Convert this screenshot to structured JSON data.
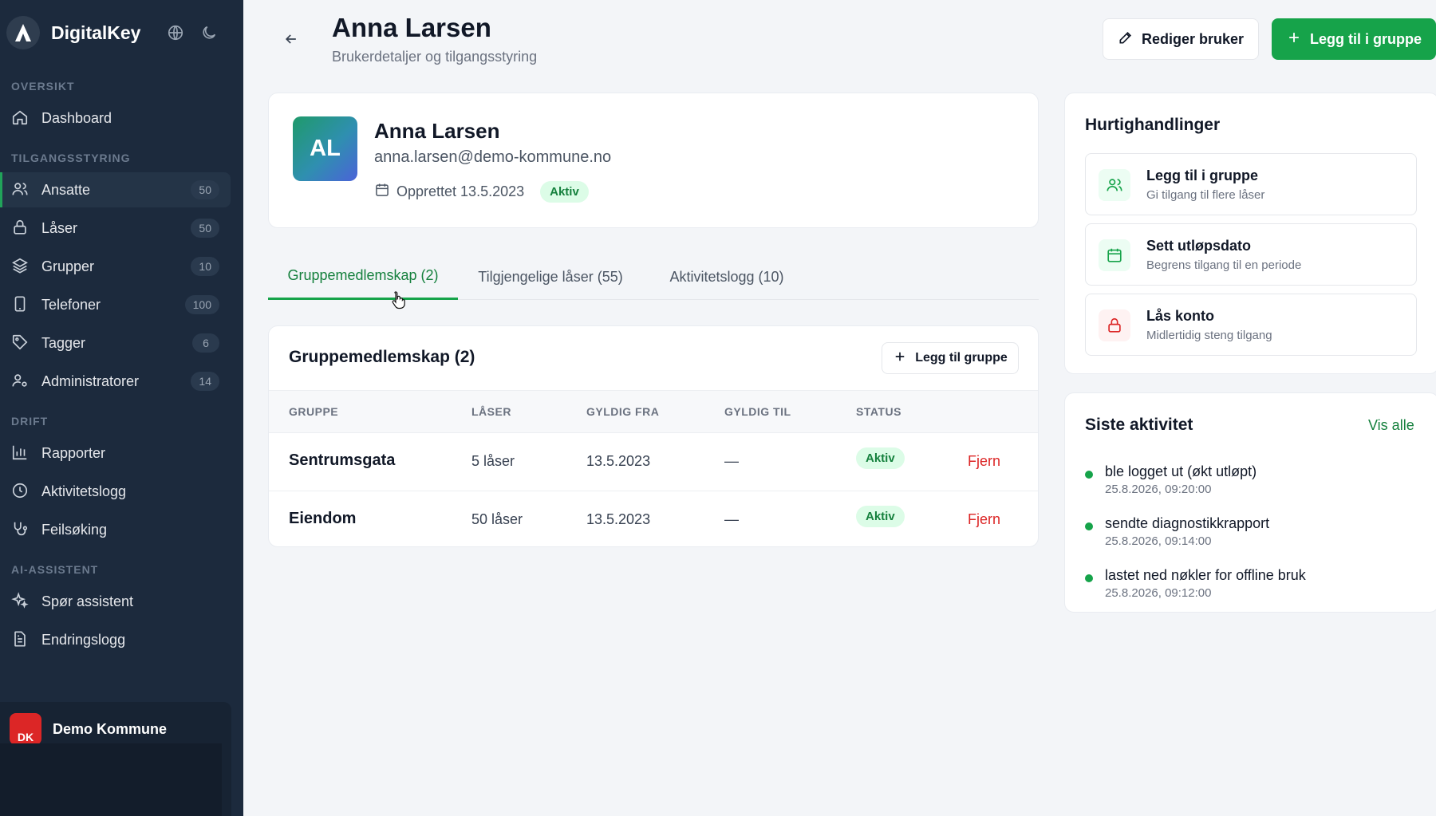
{
  "app": {
    "name": "DigitalKey"
  },
  "sidebar": {
    "sections": [
      {
        "title": "OVERSIKT"
      },
      {
        "title": "TILGANGSSTYRING"
      },
      {
        "title": "DRIFT"
      },
      {
        "title": "AI-ASSISTENT"
      }
    ],
    "items": [
      {
        "label": "Dashboard",
        "icon": "home-icon"
      },
      {
        "label": "Ansatte",
        "count": "50",
        "icon": "users-icon",
        "active": true
      },
      {
        "label": "Låser",
        "count": "50",
        "icon": "lock-icon"
      },
      {
        "label": "Grupper",
        "count": "10",
        "icon": "layers-icon"
      },
      {
        "label": "Telefoner",
        "count": "100",
        "icon": "phone-icon"
      },
      {
        "label": "Tagger",
        "count": "6",
        "icon": "tag-icon"
      },
      {
        "label": "Administratorer",
        "count": "14",
        "icon": "user-cog-icon"
      },
      {
        "label": "Rapporter",
        "icon": "bar-chart-icon"
      },
      {
        "label": "Aktivitetslogg",
        "icon": "clock-icon"
      },
      {
        "label": "Feilsøking",
        "icon": "stethoscope-icon"
      },
      {
        "label": "Spør assistent",
        "icon": "sparkles-icon"
      },
      {
        "label": "Endringslogg",
        "icon": "file-text-icon"
      }
    ],
    "org": {
      "name": "Demo Kommune",
      "initials": "DK"
    }
  },
  "header": {
    "title": "Anna Larsen",
    "subtitle": "Brukerdetaljer og tilgangsstyring",
    "edit_label": "Rediger bruker",
    "add_label": "Legg til i gruppe"
  },
  "profile": {
    "initials": "AL",
    "name": "Anna Larsen",
    "email": "anna.larsen@demo-kommune.no",
    "created": "Opprettet 13.5.2023",
    "status": "Aktiv"
  },
  "tabs": [
    {
      "label": "Gruppemedlemskap (2)",
      "active": true
    },
    {
      "label": "Tilgjengelige låser (55)"
    },
    {
      "label": "Aktivitetslogg (10)"
    }
  ],
  "groups": {
    "title": "Gruppemedlemskap (2)",
    "add_label": "Legg til gruppe",
    "columns": [
      "GRUPPE",
      "LÅSER",
      "GYLDIG FRA",
      "GYLDIG TIL",
      "STATUS"
    ],
    "rows": [
      {
        "name": "Sentrumsgata",
        "locks": "5 låser",
        "from": "13.5.2023",
        "to": "—",
        "status": "Aktiv",
        "action": "Fjern"
      },
      {
        "name": "Eiendom",
        "locks": "50 låser",
        "from": "13.5.2023",
        "to": "—",
        "status": "Aktiv",
        "action": "Fjern"
      }
    ]
  },
  "quick_actions": {
    "title": "Hurtighandlinger",
    "items": [
      {
        "title": "Legg til i gruppe",
        "subtitle": "Gi tilgang til flere låser",
        "icon": "users-icon"
      },
      {
        "title": "Sett utløpsdato",
        "subtitle": "Begrens tilgang til en periode",
        "icon": "calendar-icon"
      },
      {
        "title": "Lås konto",
        "subtitle": "Midlertidig steng tilgang",
        "icon": "lock-icon"
      }
    ]
  },
  "activity": {
    "title": "Siste aktivitet",
    "see_all": "Vis alle",
    "items": [
      {
        "text": "ble logget ut (økt utløpt)",
        "time": "25.8.2026, 09:20:00"
      },
      {
        "text": "sendte diagnostikkrapport",
        "time": "25.8.2026, 09:14:00"
      },
      {
        "text": "lastet ned nøkler for offline bruk",
        "time": "25.8.2026, 09:12:00"
      }
    ]
  },
  "colors": {
    "accent": "#16a34a",
    "sidebar": "#1c2a3d",
    "danger": "#dc2626"
  }
}
